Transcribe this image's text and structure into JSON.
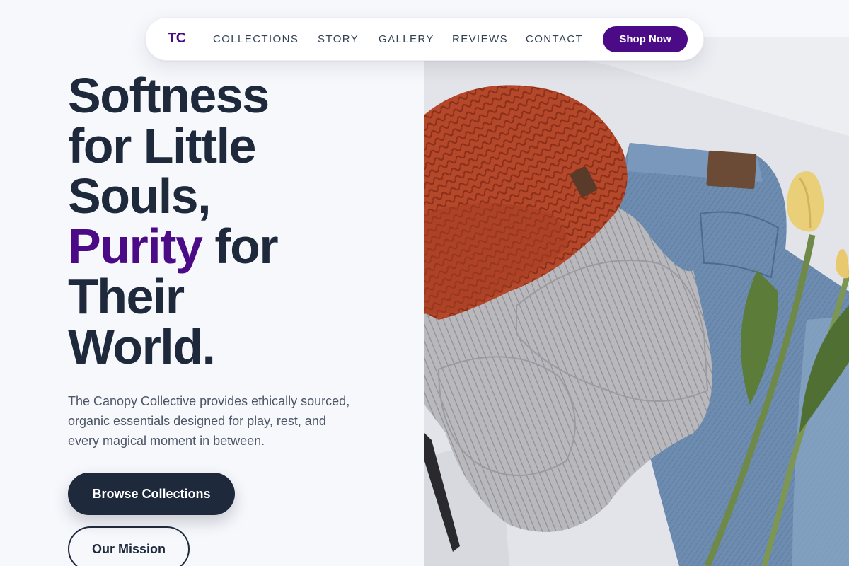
{
  "nav": {
    "logo": "TC",
    "links": [
      "COLLECTIONS",
      "STORY",
      "GALLERY",
      "REVIEWS",
      "CONTACT"
    ],
    "cta": "Shop Now"
  },
  "hero": {
    "title_line1": "Softness",
    "title_line2": "for Little",
    "title_line3": "Souls,",
    "title_accent": "Purity",
    "title_line4_rest": " for",
    "title_line5": "Their",
    "title_line6": "World.",
    "description": "The Canopy Collective provides ethically sourced, organic essentials designed for play, rest, and every magical moment in between.",
    "primary_button": "Browse Collections",
    "secondary_button": "Our Mission"
  },
  "colors": {
    "brand": "#4b0a86",
    "dark": "#1e293b",
    "background": "#f7f8fc"
  }
}
